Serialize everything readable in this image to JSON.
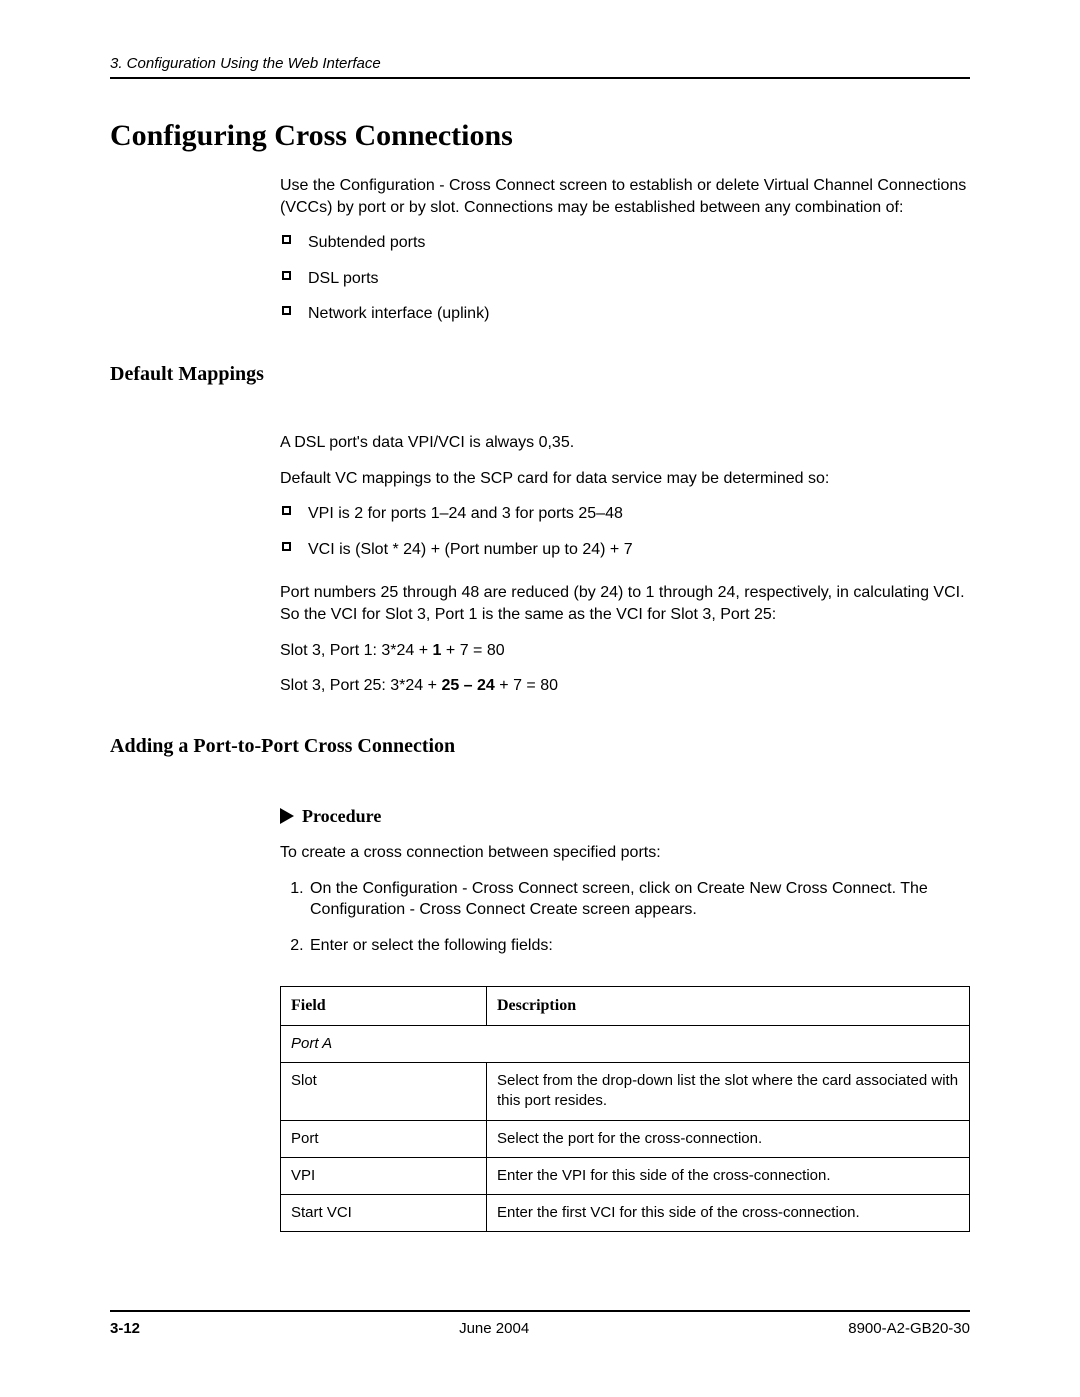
{
  "header": {
    "chapter": "3. Configuration Using the Web Interface"
  },
  "title": "Configuring Cross Connections",
  "intro": "Use the Configuration - Cross Connect screen to establish or delete Virtual Channel Connections (VCCs) by port or by slot. Connections may be established between any combination of:",
  "intro_bullets": [
    "Subtended ports",
    "DSL ports",
    "Network interface (uplink)"
  ],
  "default_mappings": {
    "heading": "Default Mappings",
    "p1": "A DSL port's data VPI/VCI is always 0,35.",
    "p2": "Default VC mappings to the SCP card for data service may be determined so:",
    "bullets": [
      "VPI is 2 for ports 1–24 and 3 for ports 25–48",
      "VCI is (Slot * 24) + (Port number up to 24) + 7"
    ],
    "p3": "Port numbers 25 through 48 are reduced (by 24) to 1 through 24, respectively, in calculating VCI. So the VCI for Slot 3, Port 1 is the same as the VCI for Slot 3, Port 25:",
    "eq1_pre": "Slot 3, Port 1:   3*24 + ",
    "eq1_bold": "1",
    "eq1_post": " + 7 = 80",
    "eq2_pre": "Slot 3, Port 25:  3*24 + ",
    "eq2_bold": "25 – 24",
    "eq2_post": " + 7 = 80"
  },
  "adding": {
    "heading": "Adding a Port-to-Port Cross Connection",
    "procedure_label": "Procedure",
    "intro": "To create a cross connection between specified ports:",
    "steps": [
      "On the Configuration - Cross Connect screen, click on Create New Cross Connect. The Configuration - Cross Connect Create screen appears.",
      "Enter or select the following fields:"
    ],
    "table": {
      "head_field": "Field",
      "head_desc": "Description",
      "group": "Port A",
      "rows": [
        {
          "field": "Slot",
          "desc": "Select from the drop-down list the slot where the card associated with this port resides."
        },
        {
          "field": "Port",
          "desc": "Select the port for the cross-connection."
        },
        {
          "field": "VPI",
          "desc": "Enter the VPI for this side of the cross-connection."
        },
        {
          "field": "Start VCI",
          "desc": "Enter the first VCI for this side of the cross-connection."
        }
      ]
    }
  },
  "footer": {
    "page": "3-12",
    "date": "June 2004",
    "docnum": "8900-A2-GB20-30"
  }
}
